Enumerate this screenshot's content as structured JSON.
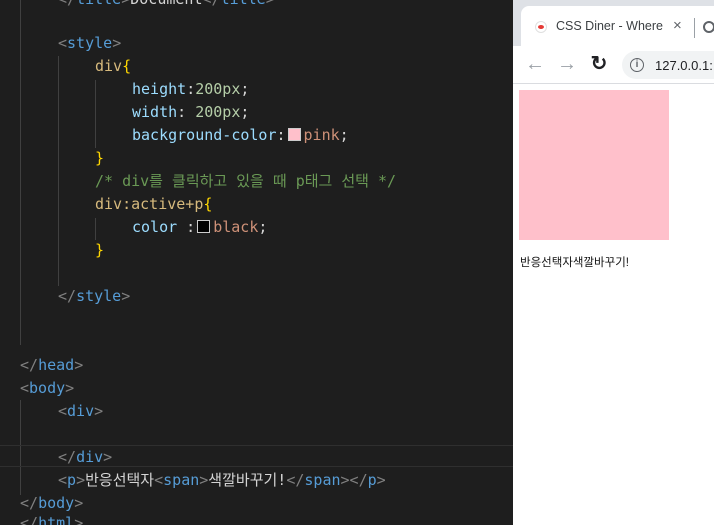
{
  "editor": {
    "lines": {
      "l0": {
        "open": "</",
        "tag": "title",
        "close": ">",
        "text": "Document",
        "open2": "</",
        "tag2": "title",
        "close2": ">"
      },
      "l1": {
        "open": "<",
        "tag": "style",
        "close": ">"
      },
      "l2": {
        "selector": "div",
        "brace": "{"
      },
      "l3": {
        "prop": "height",
        "colon": ":",
        "value": "200px",
        "semi": ";"
      },
      "l4": {
        "prop": "width",
        "colon": ": ",
        "value": "200px",
        "semi": ";"
      },
      "l5": {
        "prop": "background-color",
        "colon": ":",
        "value": "pink",
        "semi": ";",
        "swatch": "#ffc0cb"
      },
      "l6": {
        "brace": "}"
      },
      "l7": {
        "comment": "/* div를 클릭하고 있을 때 p태그 선택 */"
      },
      "l8": {
        "selector": "div:active+p",
        "brace": "{"
      },
      "l9": {
        "prop": "color",
        "colon": " :",
        "value": "black",
        "semi": ";",
        "swatch": "#000000"
      },
      "l10": {
        "brace": "}"
      },
      "l11": {
        "open": "</",
        "tag": "style",
        "close": ">"
      },
      "l12": {
        "open": "</",
        "tag": "head",
        "close": ">"
      },
      "l13": {
        "open": "<",
        "tag": "body",
        "close": ">"
      },
      "l14": {
        "open": "<",
        "tag": "div",
        "close": ">"
      },
      "l15": {
        "open": "</",
        "tag": "div",
        "close": ">"
      },
      "l16": {
        "open": "<",
        "tag": "p",
        "close": ">",
        "text": "반응선택자",
        "open2": "<",
        "tag2": "span",
        "close2": ">",
        "text2": "색깔바꾸기!",
        "open3": "</",
        "tag3": "span",
        "close3": ">",
        "open4": "</",
        "tag4": "p",
        "close4": ">"
      },
      "l17": {
        "open": "</",
        "tag": "body",
        "close": ">"
      },
      "l18": {
        "open": "</",
        "tag": "html",
        "close": ">"
      }
    }
  },
  "browser": {
    "tab_title": "CSS Diner - Where",
    "tab_close": "×",
    "url": "127.0.0.1:",
    "back": "←",
    "forward": "→",
    "reload": "↻",
    "info": "i",
    "page": {
      "box_color": "pink",
      "text": "반응선택자색깔바꾸기!"
    }
  }
}
